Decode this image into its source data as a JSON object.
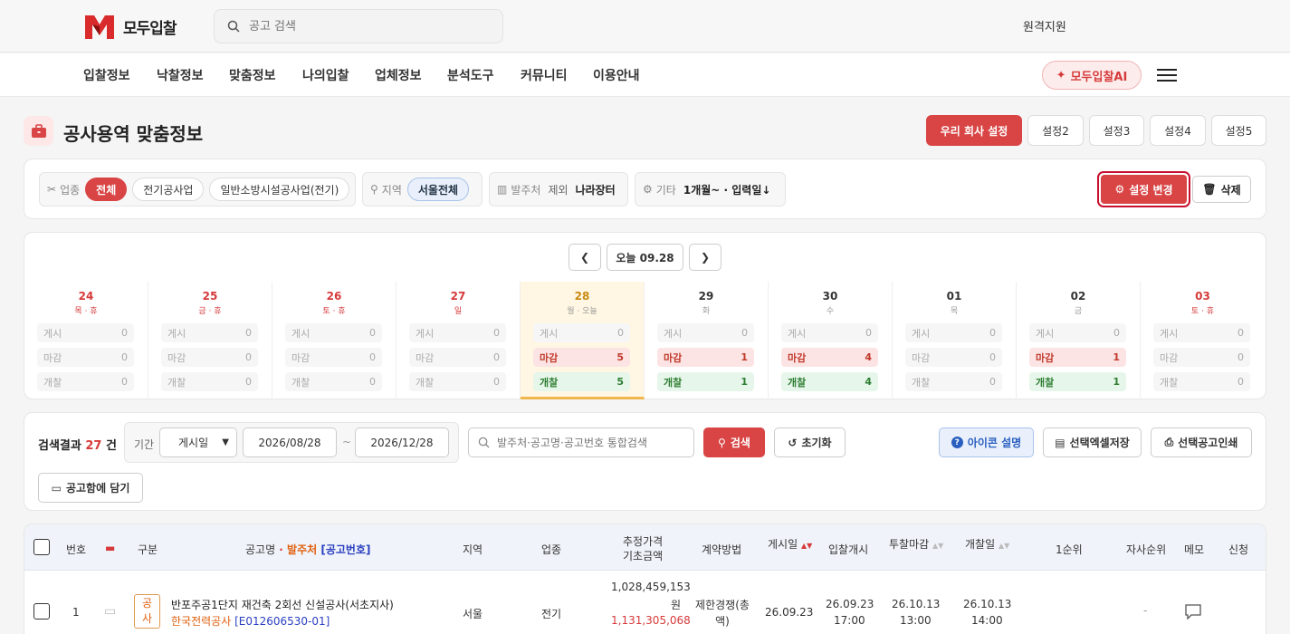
{
  "header": {
    "logo_text": "모두입찰",
    "search_placeholder": "공고 검색",
    "remote_support": "원격지원"
  },
  "nav": {
    "items": [
      "입찰정보",
      "낙찰정보",
      "맞춤정보",
      "나의입찰",
      "업체정보",
      "분석도구",
      "커뮤니티",
      "이용안내"
    ],
    "ai_button": "모두입찰AI"
  },
  "page": {
    "title": "공사용역 맞춤정보",
    "settings": [
      "우리 회사 설정",
      "설정2",
      "설정3",
      "설정4",
      "설정5"
    ]
  },
  "filters": {
    "industry_label": "업종",
    "industry_chips": [
      "전체",
      "전기공사업",
      "일반소방시설공사업(전기)"
    ],
    "region_label": "지역",
    "region_chip": "서울전체",
    "orderer_label": "발주처",
    "orderer_exclude": "제외",
    "orderer_value": "나라장터",
    "etc_label": "기타",
    "etc_value": "1개월~ · 입력일↓",
    "edit_button": "설정 변경",
    "delete_button": "삭제"
  },
  "calendar": {
    "today_label": "오늘 09.28",
    "row_labels": [
      "게시",
      "마감",
      "개찰"
    ],
    "days": [
      {
        "num": "24",
        "sub": "목 · 휴",
        "counts": [
          "0",
          "0",
          "0"
        ]
      },
      {
        "num": "25",
        "sub": "금 · 휴",
        "counts": [
          "0",
          "0",
          "0"
        ]
      },
      {
        "num": "26",
        "sub": "토 · 휴",
        "counts": [
          "0",
          "0",
          "0"
        ]
      },
      {
        "num": "27",
        "sub": "일",
        "counts": [
          "0",
          "0",
          "0"
        ]
      },
      {
        "num": "28",
        "sub": "월 · 오늘",
        "counts": [
          "0",
          "5",
          "5"
        ]
      },
      {
        "num": "29",
        "sub": "화",
        "counts": [
          "0",
          "1",
          "1"
        ]
      },
      {
        "num": "30",
        "sub": "수",
        "counts": [
          "0",
          "4",
          "4"
        ]
      },
      {
        "num": "01",
        "sub": "목",
        "counts": [
          "0",
          "0",
          "0"
        ]
      },
      {
        "num": "02",
        "sub": "금",
        "counts": [
          "0",
          "1",
          "1"
        ]
      },
      {
        "num": "03",
        "sub": "토 · 휴",
        "counts": [
          "0",
          "0",
          "0"
        ]
      }
    ]
  },
  "search": {
    "result_prefix": "검색결과",
    "result_count": "27",
    "result_suffix": "건",
    "period_label": "기간",
    "period_select": "게시일",
    "date_from": "2026/08/28",
    "date_sep": "~",
    "date_to": "2026/12/28",
    "query_placeholder": "발주처·공고명·공고번호 통합검색",
    "search_button": "검색",
    "reset_button": "초기화",
    "icon_help": "아이콘 설명",
    "excel_save": "선택엑셀저장",
    "print": "선택공고인쇄",
    "save_box": "공고함에 담기"
  },
  "table": {
    "headers": {
      "no": "번호",
      "type": "구분",
      "name_a": "공고명",
      "name_dot": " · ",
      "name_b": "발주처",
      "name_c": " [공고번호]",
      "region": "지역",
      "industry": "업종",
      "price_1": "추정가격",
      "price_2": "기초금액",
      "contract": "계약방법",
      "posted": "게시일",
      "bid_open": "입찰개시",
      "bid_close": "투찰마감",
      "open": "개찰일",
      "rank1": "1순위",
      "own_rank": "자사순위",
      "memo": "메모",
      "apply": "신청"
    },
    "rows": [
      {
        "no": "1",
        "type": "공사",
        "title": "반포주공1단지 재건축 2회선 신설공사(서초지사)",
        "orderer": "한국전력공사",
        "notice_no": "[E012606530-01]",
        "region": "서울",
        "industry": "전기",
        "est_price": "1,028,459,153",
        "est_unit": "원",
        "base_price": "1,131,305,068",
        "contract": "제한경쟁(총액)",
        "posted": "26.09.23",
        "bid_open_d": "26.09.23",
        "bid_open_t": "17:00",
        "bid_close_d": "26.10.13",
        "bid_close_t": "13:00",
        "open_d": "26.10.13",
        "open_t": "14:00",
        "rank1": "-"
      }
    ]
  },
  "colors": {
    "accent": "#d94545",
    "holiday": "#d63a3a",
    "today": "#f0b64b"
  }
}
